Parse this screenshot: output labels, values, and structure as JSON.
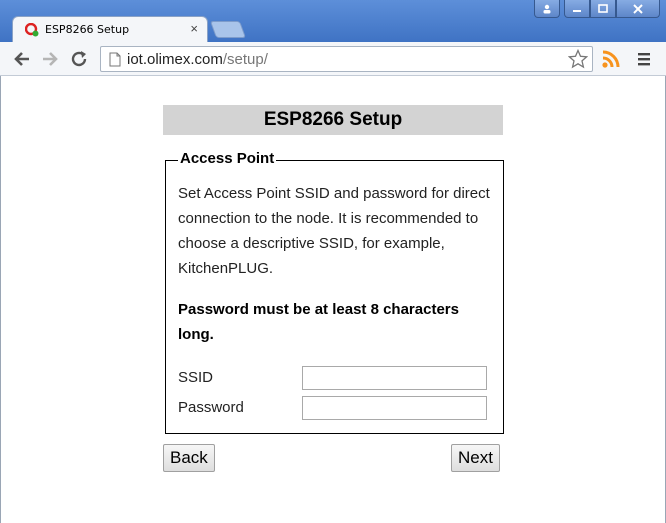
{
  "browser": {
    "tab_title": "ESP8266 Setup",
    "tab_close": "×",
    "url_host": "iot.olimex.com",
    "url_path": "/setup/"
  },
  "page": {
    "title": "ESP8266 Setup",
    "fieldset_legend": "Access Point",
    "description": "Set Access Point SSID and password for direct connection to the node. It is recommended to choose a descriptive SSID, for example, KitchenPLUG.",
    "warning": "Password must be at least 8 characters long.",
    "fields": {
      "ssid_label": "SSID",
      "ssid_value": "",
      "password_label": "Password",
      "password_value": ""
    },
    "buttons": {
      "back": "Back",
      "next": "Next"
    }
  },
  "colors": {
    "title_bg": "#d3d3d3",
    "rss_orange": "#f7931e"
  }
}
